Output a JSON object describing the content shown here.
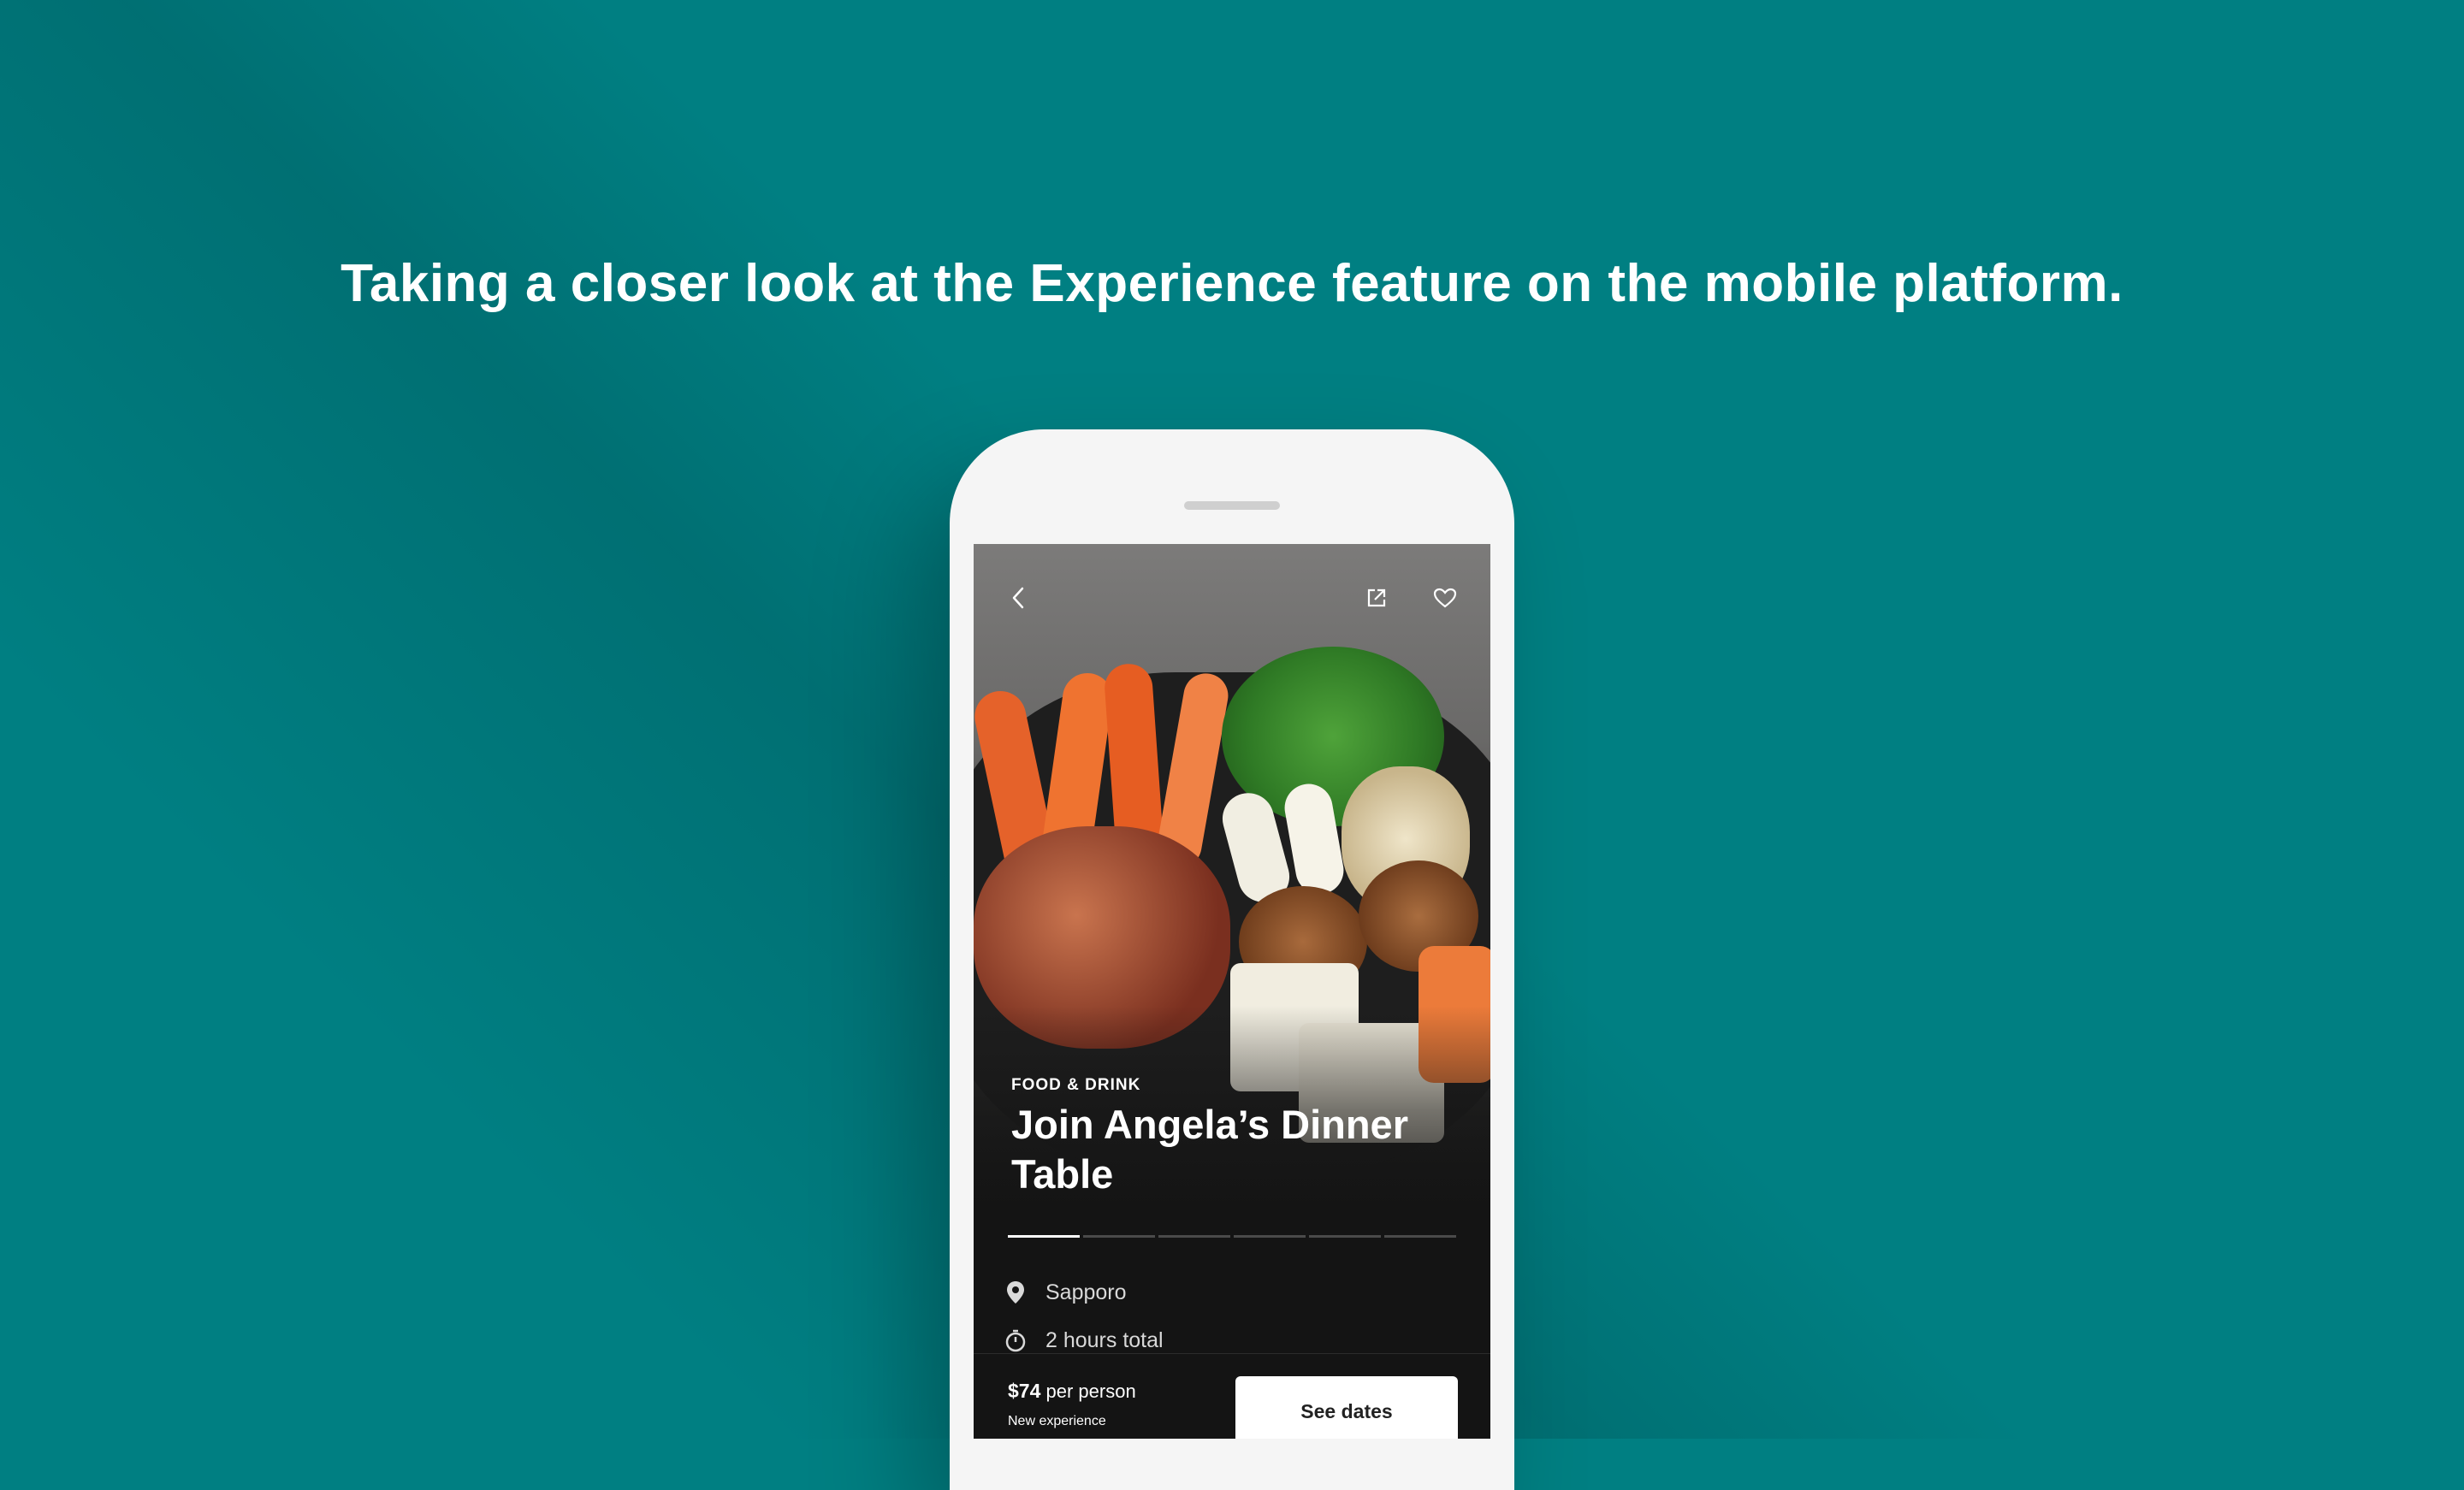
{
  "headline": "Taking a closer look at the Experience feature on the mobile platform.",
  "experience": {
    "category": "FOOD & DRINK",
    "title": "Join Angela’s Dinner Table",
    "photo_progress": {
      "total_segments": 6,
      "active_index": 0
    },
    "details": [
      {
        "icon": "location-pin-icon",
        "text": "Sapporo"
      },
      {
        "icon": "timer-icon",
        "text": "2 hours total"
      }
    ]
  },
  "top_actions": {
    "back": "back-chevron-icon",
    "share": "share-icon",
    "favorite": "heart-icon"
  },
  "booking": {
    "price": "$74",
    "price_unit": "per person",
    "note": "New experience",
    "cta": "See dates"
  },
  "colors": {
    "background": "#007f82",
    "screen": "#141414",
    "text_light": "#ffffff"
  }
}
